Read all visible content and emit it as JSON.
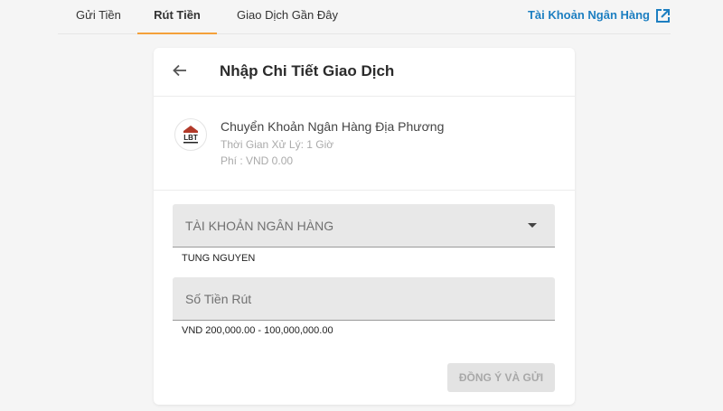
{
  "nav": {
    "tabs": [
      {
        "label": "Gửi Tiền"
      },
      {
        "label": "Rút Tiền",
        "active": true
      },
      {
        "label": "Giao Dịch Gần Đây"
      }
    ],
    "bank_account_link": "Tài Khoản Ngân Hàng",
    "accent_color": "#f4a13a",
    "link_color": "#1d7fc1"
  },
  "card": {
    "title": "Nhập Chi Tiết Giao Dịch",
    "method": {
      "logo_icon": "bank-logo-icon",
      "logo_text": "LBT",
      "name": "Chuyển Khoản Ngân Hàng Địa Phương",
      "processing_time": "Thời Gian Xử Lý: 1 Giờ",
      "fee": "Phí : VND 0.00"
    },
    "bank_account_field": {
      "label": "TÀI KHOẢN NGÂN HÀNG",
      "helper": "TUNG NGUYEN"
    },
    "amount_field": {
      "label": "Số Tiền Rút",
      "helper": "VND 200,000.00 - 100,000,000.00"
    },
    "submit_label": "ĐỒNG Ý VÀ GỬI"
  }
}
